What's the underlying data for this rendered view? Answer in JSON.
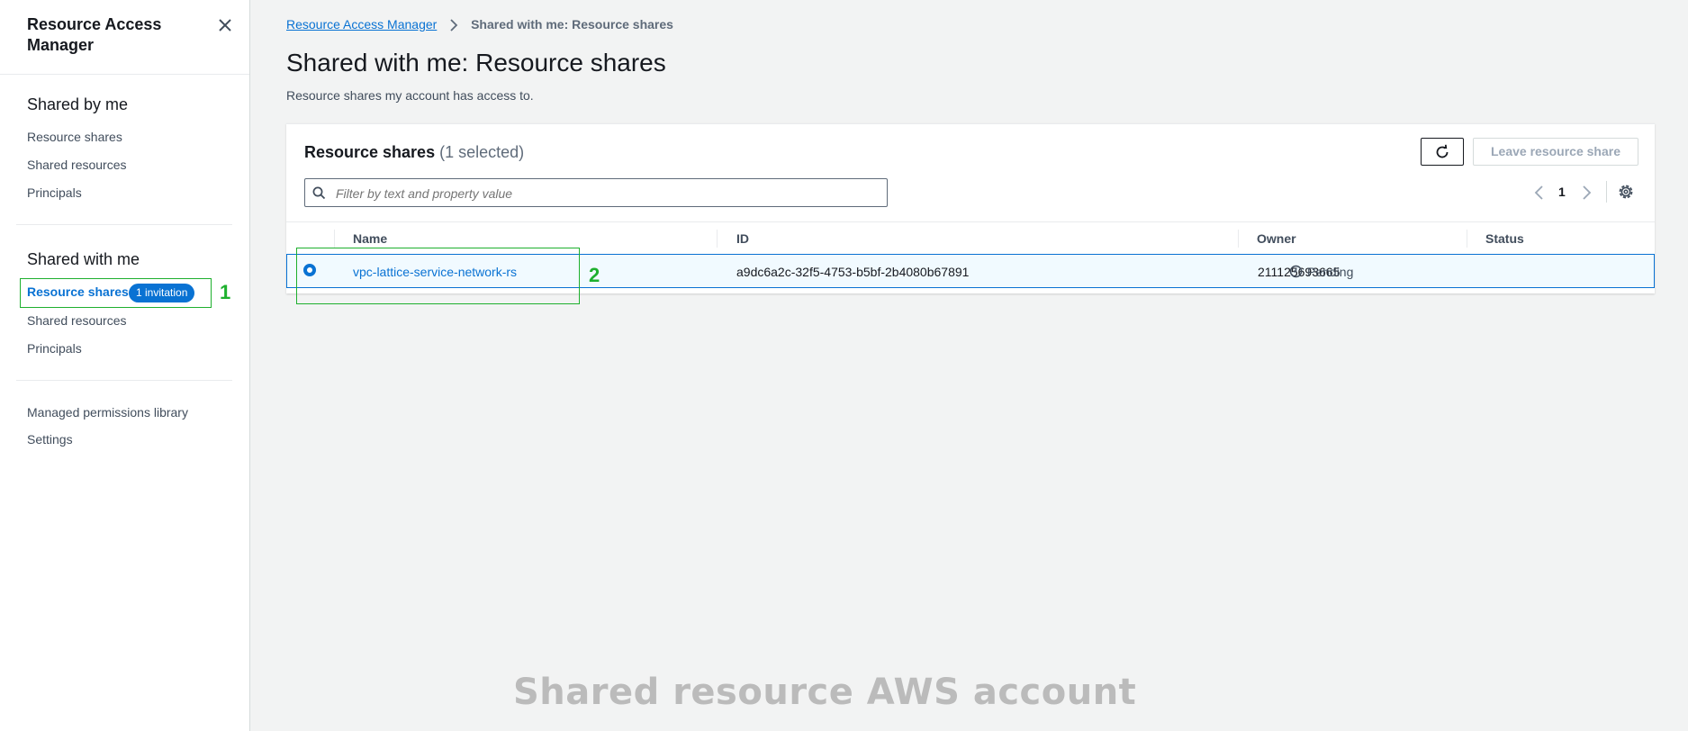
{
  "sidebar": {
    "title": "Resource Access Manager",
    "shared_by_me": {
      "title": "Shared by me",
      "items": [
        "Resource shares",
        "Shared resources",
        "Principals"
      ]
    },
    "shared_with_me": {
      "title": "Shared with me",
      "items": [
        "Resource shares",
        "Shared resources",
        "Principals"
      ],
      "badge": "1 invitation"
    },
    "other_items": [
      "Managed permissions library",
      "Settings"
    ]
  },
  "annotations": [
    "1",
    "2"
  ],
  "breadcrumb": {
    "root": "Resource Access Manager",
    "current": "Shared with me: Resource shares"
  },
  "page": {
    "title": "Shared with me: Resource shares",
    "description": "Resource shares my account has access to."
  },
  "panel": {
    "title": "Resource shares",
    "count": "(1 selected)",
    "leave_label": "Leave resource share",
    "filter_placeholder": "Filter by text and property value",
    "page_number": "1"
  },
  "table": {
    "columns": [
      "Name",
      "ID",
      "Owner",
      "Status"
    ],
    "rows": [
      {
        "name": "vpc-lattice-service-network-rs",
        "id": "a9dc6a2c-32f5-4753-b5bf-2b4080b67891",
        "owner": "211125693665",
        "status": "Pending",
        "selected": true
      }
    ]
  },
  "watermark": "Shared resource AWS account",
  "colors": {
    "accent": "#0972d3",
    "annotation": "#1eb02e",
    "background": "#f2f3f3"
  },
  "icons": [
    "close-icon",
    "chevron-right-icon",
    "refresh-icon",
    "search-icon",
    "chevron-left-icon",
    "settings-icon",
    "clock-icon"
  ]
}
